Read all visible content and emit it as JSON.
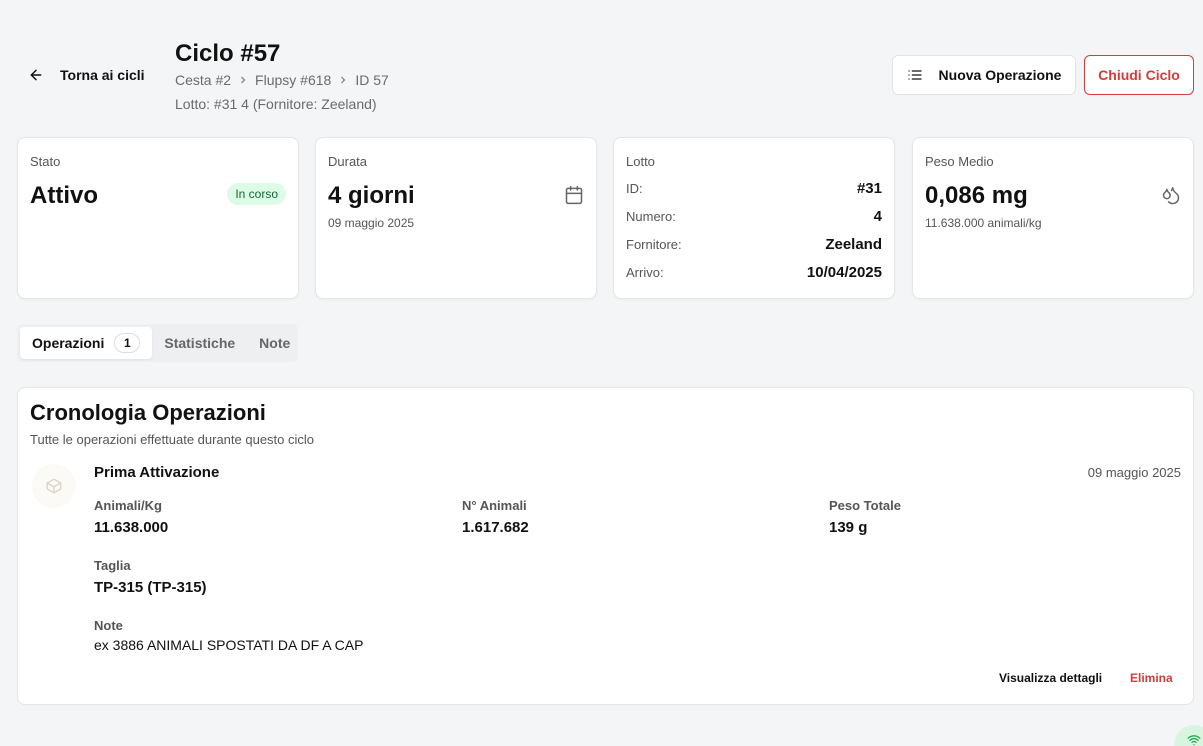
{
  "header": {
    "back_label": "Torna ai cicli",
    "title": "Ciclo #57",
    "breadcrumb": [
      "Cesta #2",
      "Flupsy #618",
      "ID 57"
    ],
    "lotto_line": "Lotto: #31 4  (Fornitore: Zeeland)",
    "new_op_label": "Nuova Operazione",
    "close_label": "Chiudi Ciclo"
  },
  "cards": {
    "stato": {
      "label": "Stato",
      "value": "Attivo",
      "badge": "In corso"
    },
    "durata": {
      "label": "Durata",
      "value": "4 giorni",
      "sub": "09 maggio 2025",
      "icon": "calendar-icon"
    },
    "lotto": {
      "label": "Lotto",
      "rows": [
        {
          "key": "ID:",
          "value": "#31"
        },
        {
          "key": "Numero:",
          "value": "4"
        },
        {
          "key": "Fornitore:",
          "value": "Zeeland"
        },
        {
          "key": "Arrivo:",
          "value": "10/04/2025"
        }
      ]
    },
    "peso": {
      "label": "Peso Medio",
      "value": "0,086 mg",
      "sub": "11.638.000 animali/kg",
      "icon": "droplets-icon"
    }
  },
  "tabs": [
    {
      "label": "Operazioni",
      "count": "1",
      "active": true
    },
    {
      "label": "Statistiche"
    },
    {
      "label": "Note"
    }
  ],
  "timeline": {
    "title": "Cronologia Operazioni",
    "subtitle": "Tutte le operazioni effettuate durante questo ciclo",
    "operation": {
      "name": "Prima Attivazione",
      "date": "09 maggio 2025",
      "icon": "box-icon",
      "fields": {
        "animali_kg": {
          "label": "Animali/Kg",
          "value": "11.638.000"
        },
        "n_animali": {
          "label": "N° Animali",
          "value": "1.617.682"
        },
        "peso_totale": {
          "label": "Peso Totale",
          "value": "139 g"
        },
        "taglia": {
          "label": "Taglia",
          "value": "TP-315 (TP-315)"
        },
        "note": {
          "label": "Note",
          "value": "ex 3886 ANIMALI SPOSTATI DA DF A CAP"
        }
      },
      "details_label": "Visualizza dettagli",
      "delete_label": "Elimina"
    }
  },
  "colors": {
    "danger": "#d73a3a",
    "success_bg": "#dcfce7",
    "success_text": "#166534"
  }
}
